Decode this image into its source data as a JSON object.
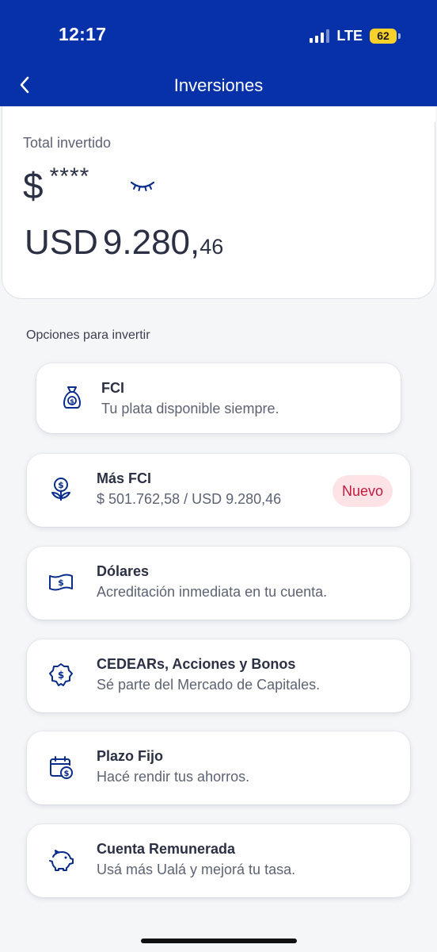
{
  "status_bar": {
    "time": "12:17",
    "network": "LTE",
    "battery": "62"
  },
  "nav": {
    "title": "Inversiones",
    "back_icon": "chevron-left-icon"
  },
  "total": {
    "label": "Total invertido",
    "ars_symbol": "$",
    "ars_masked": "****",
    "visibility_icon": "eye-closed-icon",
    "usd_currency": "USD",
    "usd_integer": "9.280,",
    "usd_decimals": "46"
  },
  "section": {
    "title": "Opciones para invertir"
  },
  "options": [
    {
      "title": "FCI",
      "subtitle": "Tu plata disponible siempre.",
      "icon": "money-bag-icon"
    },
    {
      "title": "Más FCI",
      "subtitle": "$ 501.762,58 / USD 9.280,46",
      "icon": "money-plant-icon",
      "badge": "Nuevo"
    },
    {
      "title": "Dólares",
      "subtitle": "Acreditación inmediata en tu cuenta.",
      "icon": "banknote-icon"
    },
    {
      "title": "CEDEARs, Acciones y Bonos",
      "subtitle": "Sé parte del Mercado de Capitales.",
      "icon": "badge-dollar-icon"
    },
    {
      "title": "Plazo Fijo",
      "subtitle": "Hacé rendir tus ahorros.",
      "icon": "calendar-dollar-icon"
    },
    {
      "title": "Cuenta Remunerada",
      "subtitle": "Usá más Ualá y mejorá tu tasa.",
      "icon": "piggy-bank-icon"
    }
  ],
  "colors": {
    "header": "#0631a8",
    "icon": "#0a2d8c",
    "badge_bg": "#fde3e6",
    "badge_text": "#c31a3d",
    "battery": "#f8d12b"
  }
}
